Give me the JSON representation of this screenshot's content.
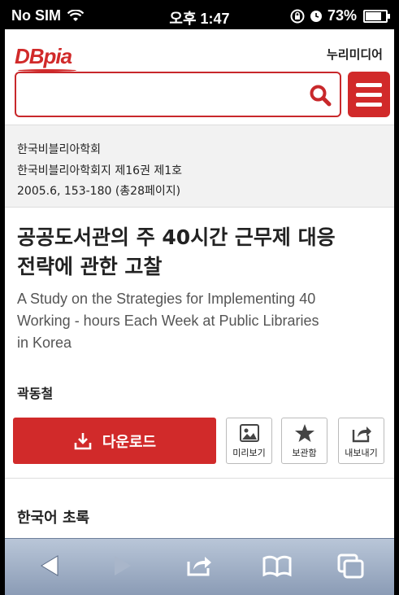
{
  "status_bar": {
    "carrier": "No SIM",
    "time": "오후 1:47",
    "battery": "73%",
    "battery_level": 0.73,
    "icons": [
      "wifi-icon",
      "rotation-lock-icon",
      "alarm-icon",
      "battery-icon"
    ]
  },
  "header": {
    "logo_text": "DBpia",
    "brand_right": "누리미디어",
    "search_placeholder": "",
    "accent_color": "#d12a2a"
  },
  "paper_meta": {
    "society": "한국비블리아학회",
    "journal": "한국비블리아학회지 제16권 제1호",
    "pages": "2005.6, 153-180 (총28페이지)"
  },
  "article": {
    "title_line1": "공공도서관의 주 40시간 근무제 대응",
    "title_line2": "전략에 관한 고찰",
    "subtitle_line1": "A Study on the Strategies for Implementing 40",
    "subtitle_line2": "Working - hours Each Week at Public Libraries",
    "subtitle_line3": "in Korea",
    "author": "곽동철"
  },
  "actions": {
    "download": "다운로드",
    "preview": "미리보기",
    "save": "보관함",
    "export": "내보내기"
  },
  "abstract": {
    "heading": "한국어 초록"
  },
  "toolbar": {
    "icons": [
      "back-icon",
      "forward-icon",
      "share-icon",
      "bookmarks-icon",
      "tabs-icon"
    ]
  }
}
